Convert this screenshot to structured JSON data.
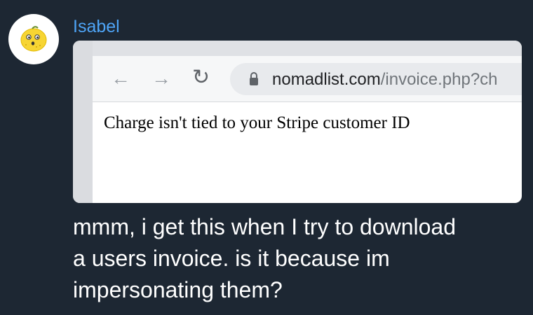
{
  "message": {
    "sender": "Isabel",
    "text_lines": [
      "mmm, i get this when I try to download",
      "a users invoice. is it because im",
      "impersonating them?"
    ]
  },
  "screenshot": {
    "browser": {
      "back_icon": "arrow-left",
      "forward_icon": "arrow-right",
      "reload_icon": "reload",
      "url_host": "nomadlist.com",
      "url_path": "/invoice.php?ch"
    },
    "page_text": "Charge isn't tied to your Stripe customer ID"
  },
  "colors": {
    "background": "#1d2733",
    "sender_name": "#4ea4f6",
    "message_text": "#ffffff",
    "avatar_lemon": "#f7d533"
  }
}
